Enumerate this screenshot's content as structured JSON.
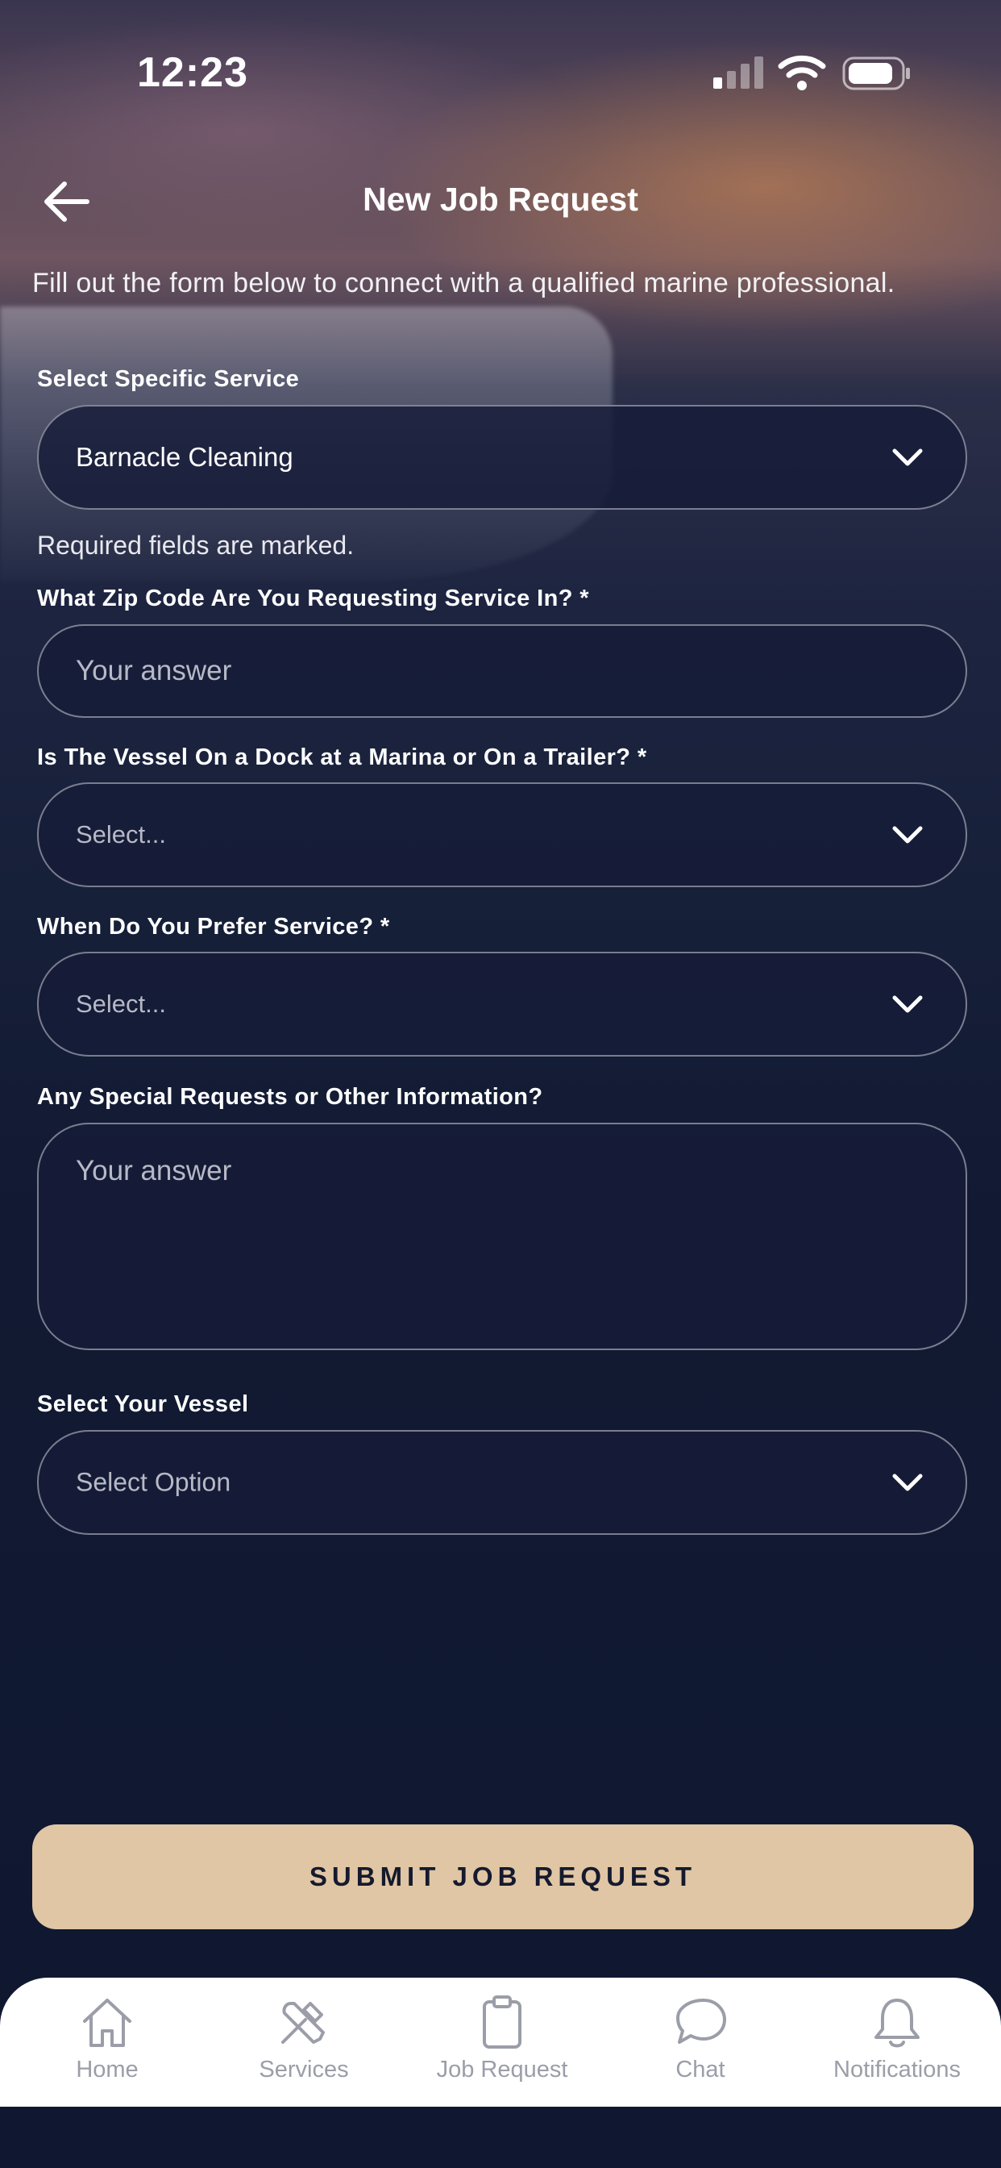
{
  "status_bar": {
    "time": "12:23"
  },
  "header": {
    "title": "New Job Request"
  },
  "subtitle": "Fill out the form below to connect with a qualified marine professional.",
  "form": {
    "service": {
      "label": "Select Specific Service",
      "value": "Barnacle Cleaning"
    },
    "required_note": "Required fields are marked.",
    "zip": {
      "label": "What Zip Code Are You Requesting Service In? *",
      "placeholder": "Your answer"
    },
    "vessel_location": {
      "label": "Is The Vessel On a Dock at a Marina or On a Trailer? *",
      "placeholder": "Select..."
    },
    "preferred_time": {
      "label": "When Do You Prefer Service? *",
      "placeholder": "Select..."
    },
    "special_requests": {
      "label": "Any Special Requests or Other Information?",
      "placeholder": "Your answer"
    },
    "vessel": {
      "label": "Select Your Vessel",
      "placeholder": "Select Option"
    }
  },
  "submit_label": "SUBMIT JOB REQUEST",
  "tabbar": {
    "items": [
      {
        "label": "Home",
        "icon": "home-icon"
      },
      {
        "label": "Services",
        "icon": "tools-icon"
      },
      {
        "label": "Job Request",
        "icon": "clipboard-icon"
      },
      {
        "label": "Chat",
        "icon": "chat-icon"
      },
      {
        "label": "Notifications",
        "icon": "bell-icon"
      }
    ]
  },
  "colors": {
    "background": "#0f1830",
    "field_bg": "#161c38",
    "submit_bg": "#e0c6a4",
    "tab_inactive": "#9b9ea8"
  }
}
